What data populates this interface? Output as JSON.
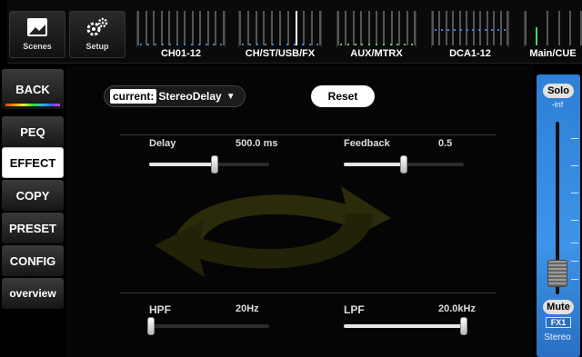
{
  "topbar": {
    "scenes_label": "Scenes",
    "setup_label": "Setup",
    "groups": [
      {
        "label": "CH01-12"
      },
      {
        "label": "CH/ST/USB/FX"
      },
      {
        "label": "AUX/MTRX"
      },
      {
        "label": "DCA1-12"
      },
      {
        "label": "Main/CUE"
      }
    ]
  },
  "sidebar": {
    "items": [
      {
        "label": "BACK"
      },
      {
        "label": "PEQ"
      },
      {
        "label": "EFFECT"
      },
      {
        "label": "COPY"
      },
      {
        "label": "PRESET"
      },
      {
        "label": "CONFIG"
      },
      {
        "label": "overview"
      }
    ],
    "active": "EFFECT"
  },
  "effect": {
    "current_label": "current:",
    "current_value": "StereoDelay",
    "reset_label": "Reset",
    "params": [
      {
        "name": "Delay",
        "value": "500.0 ms",
        "level": 0.55
      },
      {
        "name": "Feedback",
        "value": "0.5",
        "level": 0.5
      },
      {
        "name": "HPF",
        "value": "20Hz",
        "level": 0.0
      },
      {
        "name": "LPF",
        "value": "20.0kHz",
        "level": 1.0
      }
    ]
  },
  "channel": {
    "solo_label": "Solo",
    "level_text": "-inf",
    "mute_label": "Mute",
    "label": "FX1",
    "name": "Stereo",
    "color": "#2d7fd6"
  }
}
